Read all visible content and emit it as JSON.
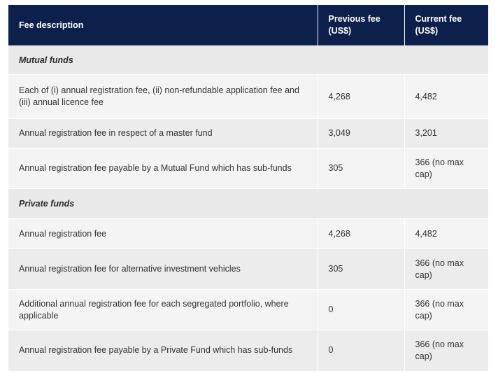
{
  "header": {
    "col1": "Fee description",
    "col2": "Previous fee (US$)",
    "col3": "Current fee (US$)"
  },
  "sections": [
    {
      "title": "Mutual funds",
      "rows": [
        {
          "desc": "Each of (i) annual registration fee, (ii) non-refundable application fee and (iii) annual licence fee",
          "prev": "4,268",
          "curr": "4,482"
        },
        {
          "desc": "Annual registration fee in respect of a master fund",
          "prev": "3,049",
          "curr": "3,201"
        },
        {
          "desc": "Annual registration fee payable by a Mutual Fund which has sub-funds",
          "prev": "305",
          "curr": "366 (no max cap)"
        }
      ]
    },
    {
      "title": "Private funds",
      "rows": [
        {
          "desc": "Annual registration fee",
          "prev": "4,268",
          "curr": "4,482"
        },
        {
          "desc": "Annual registration fee for alternative investment vehicles",
          "prev": "305",
          "curr": "366 (no max cap)"
        },
        {
          "desc": "Additional annual registration fee for each segregated portfolio, where applicable",
          "prev": "0",
          "curr": "366 (no max cap)"
        },
        {
          "desc": "Annual registration fee payable by a Private Fund which has sub-funds",
          "prev": "0",
          "curr": "366 (no max cap)"
        }
      ]
    }
  ]
}
